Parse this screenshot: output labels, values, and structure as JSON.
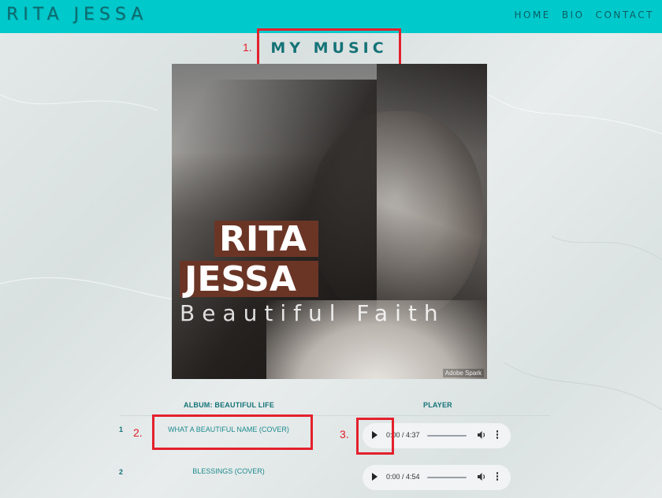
{
  "header": {
    "brand": "RITA JESSA",
    "nav": [
      "HOME",
      "BIO",
      "CONTACT"
    ],
    "background_color": "#00c9cc"
  },
  "annotations": [
    "1.",
    "2.",
    "3."
  ],
  "main": {
    "title": "MY MUSIC",
    "cover": {
      "line1": "RITA",
      "line2": "JESSA",
      "subtitle": "Beautiful Faith",
      "credit": "Adobe Spark"
    },
    "table": {
      "album_header": "ALBUM: BEAUTIFUL LIFE",
      "player_header": "PLAYER",
      "rows": [
        {
          "num": "1",
          "title": "WHAT A BEAUTIFUL NAME (COVER)",
          "time": "0:00 / 4:37"
        },
        {
          "num": "2",
          "title": "BLESSINGS (COVER)",
          "time": "0:00 / 4:54"
        }
      ]
    }
  },
  "colors": {
    "accent": "#157377",
    "highlight_box": "#e3212d"
  }
}
